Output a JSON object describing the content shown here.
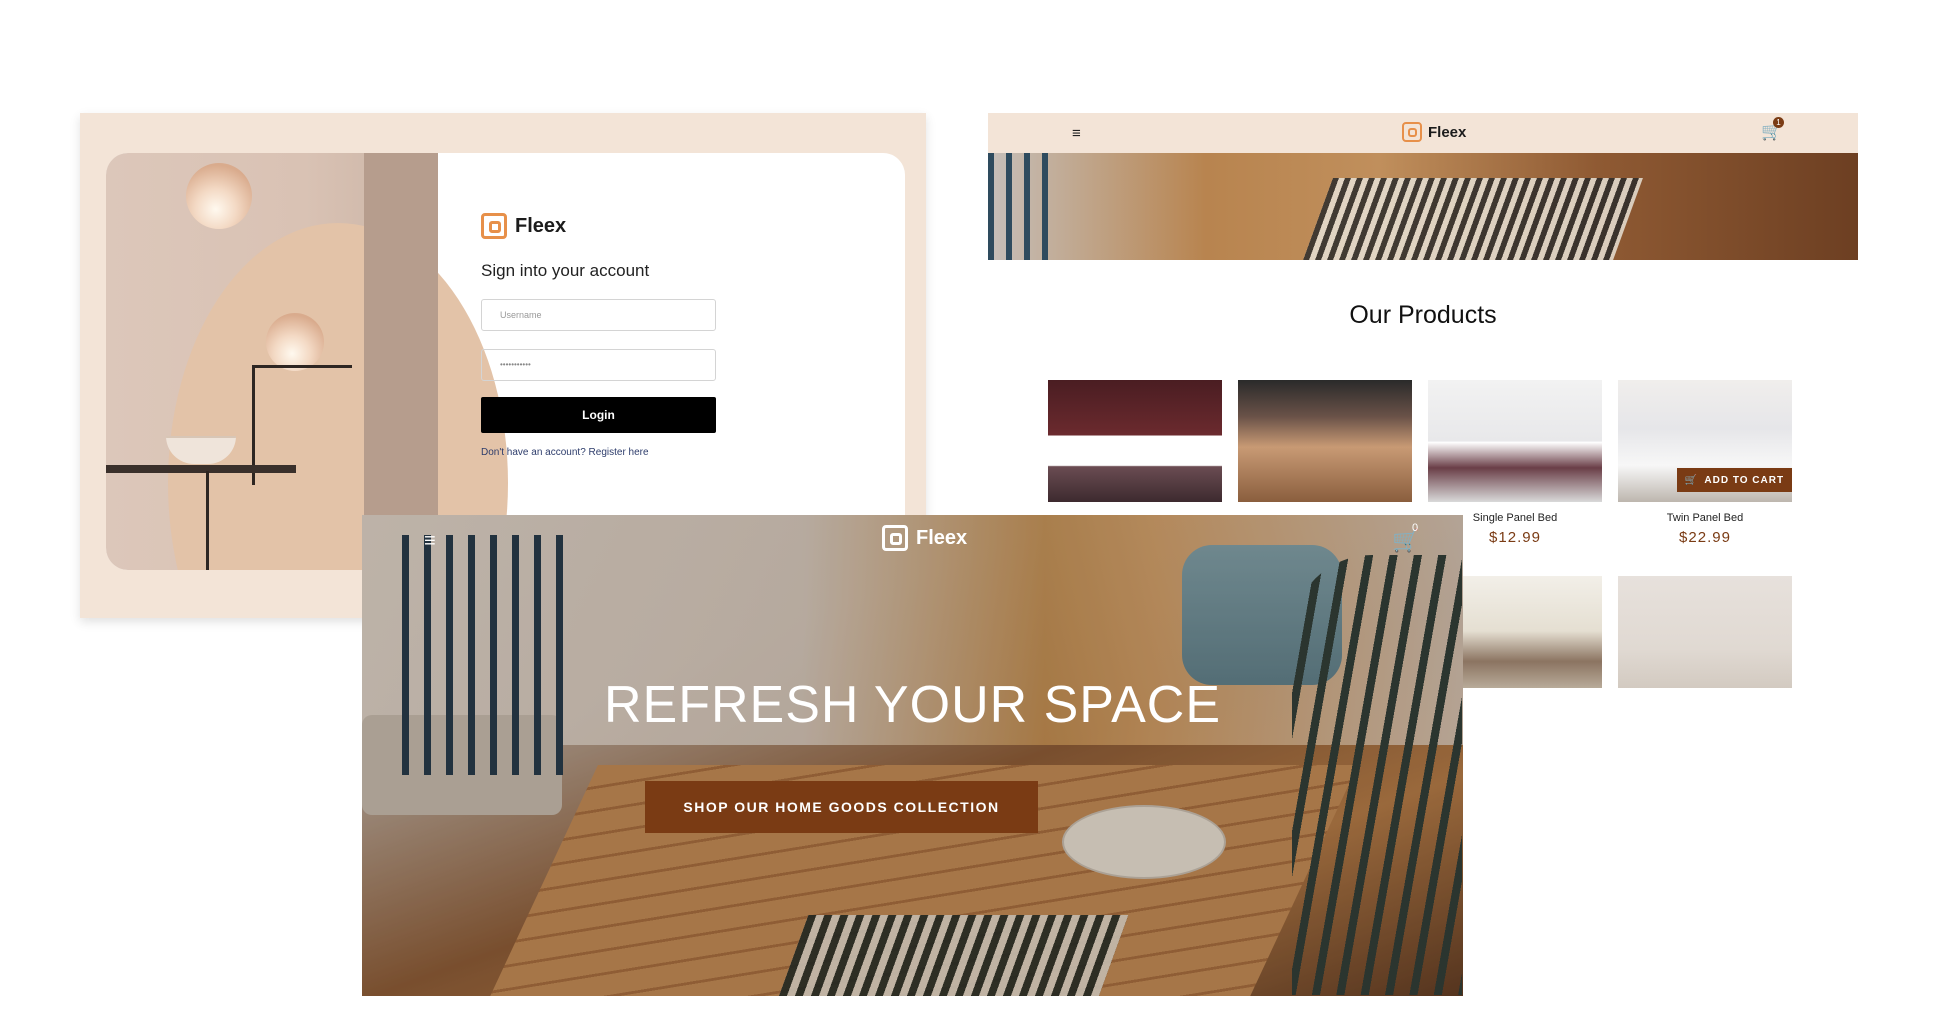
{
  "login": {
    "brand": "Fleex",
    "title": "Sign into your account",
    "username_placeholder": "Username",
    "password_value": "•••••••••••",
    "login_label": "Login",
    "register_text": "Don't have an account? Register here"
  },
  "products_page": {
    "brand": "Fleex",
    "menu_icon": "≡",
    "cart_count": "1",
    "section_title": "Our Products",
    "add_to_cart_label": "ADD TO CART",
    "products": [
      {
        "name": "",
        "price": ""
      },
      {
        "name": "",
        "price": ""
      },
      {
        "name": "Single Panel Bed",
        "price": "$12.99"
      },
      {
        "name": "Twin Panel Bed",
        "price": "$22.99"
      }
    ]
  },
  "hero": {
    "brand": "Fleex",
    "menu_icon": "≡",
    "cart_count": "0",
    "headline": "REFRESH YOUR SPACE",
    "cta_label": "SHOP OUR HOME GOODS COLLECTION"
  },
  "colors": {
    "accent_brown": "#7a3b14",
    "logo_orange": "#e7904a",
    "header_beige": "#f3e4d7"
  }
}
